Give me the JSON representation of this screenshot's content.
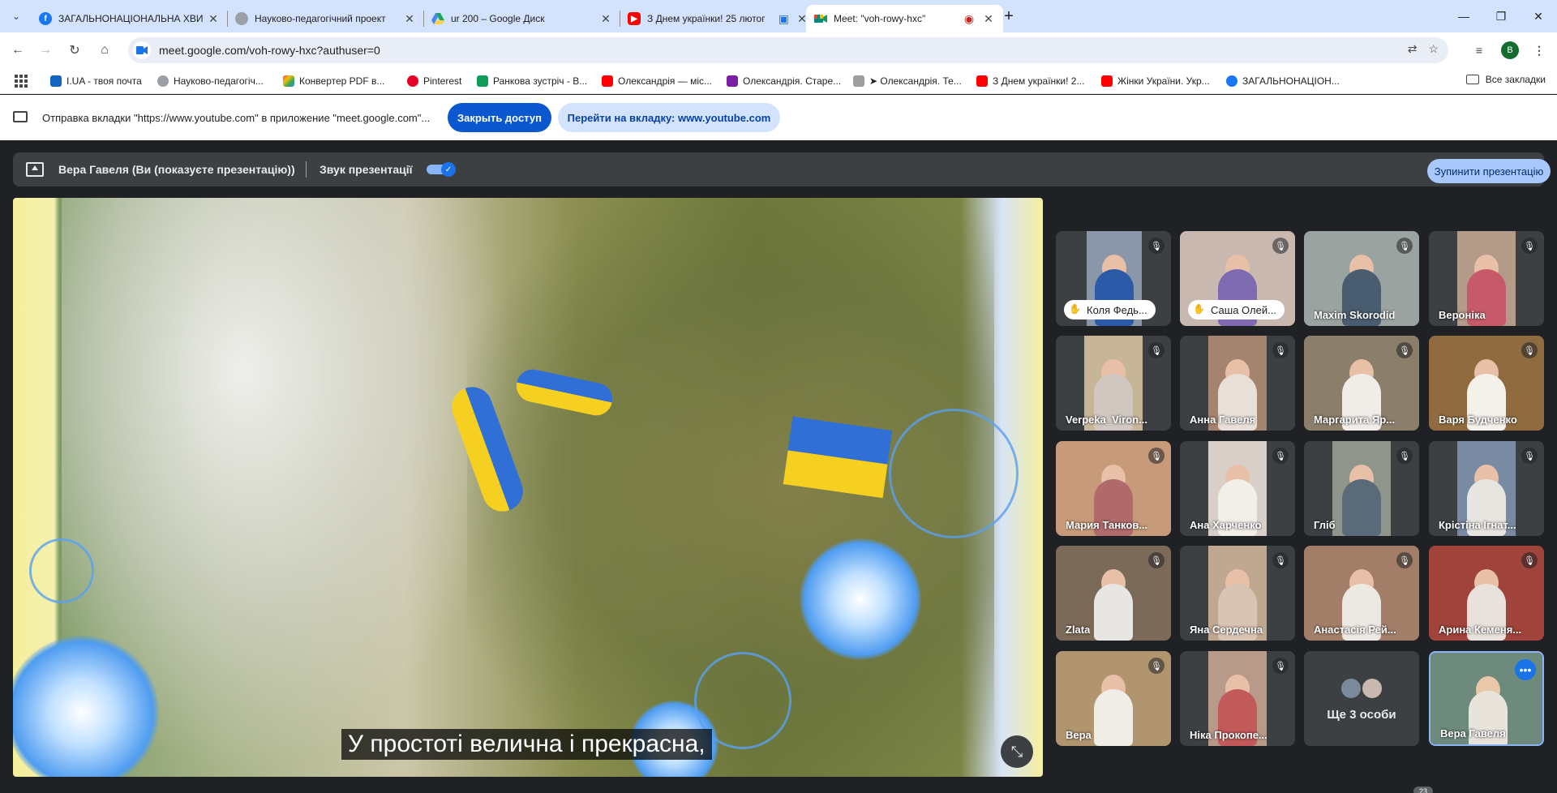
{
  "tabs": [
    {
      "title": "ЗАГАЛЬНОНАЦІОНАЛЬНА ХВИ",
      "favicon": "facebook-icon",
      "color": "#1877f2",
      "active": false
    },
    {
      "title": "Науково-педагогічний проект",
      "favicon": "globe-icon",
      "color": "#9aa0a6",
      "active": false
    },
    {
      "title": "ur 200 – Google Диск",
      "favicon": "drive-icon",
      "color": "#1fa463",
      "active": false
    },
    {
      "title": "З Днем українки! 25 лютог",
      "favicon": "youtube-icon",
      "color": "#ff0000",
      "active": false
    },
    {
      "title": "Meet: \"voh-rowy-hxc\"",
      "favicon": "meet-icon",
      "color": "#00897b",
      "active": true
    }
  ],
  "address": {
    "url": "meet.google.com/voh-rowy-hxc?authuser=0"
  },
  "profile": {
    "initial": "B"
  },
  "bookmarks": {
    "items": [
      {
        "label": "I.UA - твоя почта",
        "color": "#1565c0"
      },
      {
        "label": "Науково-педагогіч...",
        "color": "#9aa0a6"
      },
      {
        "label": "Конвертер PDF в...",
        "color": "#e8453c"
      },
      {
        "label": "Pinterest",
        "color": "#e60023"
      },
      {
        "label": "Ранкова зустріч - В...",
        "color": "#0f9d58"
      },
      {
        "label": "Олександрія — міс...",
        "color": "#ff0000"
      },
      {
        "label": "Олександрія. Старе...",
        "color": "#7b1fa2"
      },
      {
        "label": "➤ Олександрія. Те...",
        "color": "#9e9e9e"
      },
      {
        "label": "З Днем українки! 2...",
        "color": "#ff0000"
      },
      {
        "label": "Жінки України. Укр...",
        "color": "#ff0000"
      },
      {
        "label": "ЗАГАЛЬНОНАЦІОН...",
        "color": "#1877f2"
      }
    ],
    "all_label": "Все закладки"
  },
  "infobar": {
    "text": "Отправка вкладки \"https://www.youtube.com\" в приложение \"meet.google.com\"...",
    "close_label": "Закрыть доступ",
    "switch_label": "Перейти на вкладку: www.youtube.com"
  },
  "presenting": {
    "presenter_label": "Вера Гавеля (Ви (показуєте презентацію))",
    "sound_label": "Звук презентації",
    "sound_on": true,
    "stop_label": "Зупинити презентацію"
  },
  "caption": "У простоті велична і прекрасна,",
  "participants": [
    {
      "name": "Коля Федь...",
      "hand_raised": true,
      "color": "#8a97a8"
    },
    {
      "name": "Саша Олей...",
      "hand_raised": true,
      "color": "#c9b8b0"
    },
    {
      "name": "Maxim Skorodid",
      "hand_raised": false,
      "color": "#9aa3a0"
    },
    {
      "name": "Вероніка",
      "hand_raised": false,
      "color": "#b49a88"
    },
    {
      "name": "Verpeka_Viron...",
      "hand_raised": false,
      "color": "#c7b598"
    },
    {
      "name": "Анна Гавеля",
      "hand_raised": false,
      "color": "#a4846e"
    },
    {
      "name": "Маргарита Яр...",
      "hand_raised": false,
      "color": "#8b7e6a"
    },
    {
      "name": "Варя Будченко",
      "hand_raised": false,
      "color": "#8f6b3f"
    },
    {
      "name": "Мария Танков...",
      "hand_raised": false,
      "color": "#c79a7a"
    },
    {
      "name": "Ана Харченко",
      "hand_raised": false,
      "color": "#d8d0c8"
    },
    {
      "name": "Гліб",
      "hand_raised": false,
      "color": "#8f958a"
    },
    {
      "name": "Крістіна Ігнат...",
      "hand_raised": false,
      "color": "#7a8aa2"
    },
    {
      "name": "Zlata",
      "hand_raised": false,
      "color": "#7c6a58"
    },
    {
      "name": "Яна Сердечна",
      "hand_raised": false,
      "color": "#c0a890"
    },
    {
      "name": "Анастасія Рей...",
      "hand_raised": false,
      "color": "#a27e68"
    },
    {
      "name": "Арина Кеменя...",
      "hand_raised": false,
      "color": "#a0433a"
    },
    {
      "name": "Вера",
      "hand_raised": false,
      "color": "#b0956e"
    },
    {
      "name": "Ніка Прокопе...",
      "hand_raised": false,
      "color": "#b89a8a"
    },
    {
      "name": "Ще 3 особи",
      "hand_raised": false,
      "color": "#3c4043"
    },
    {
      "name": "Вера Гавеля",
      "hand_raised": false,
      "color": "#6d8a7d"
    }
  ],
  "participant_count": "23"
}
